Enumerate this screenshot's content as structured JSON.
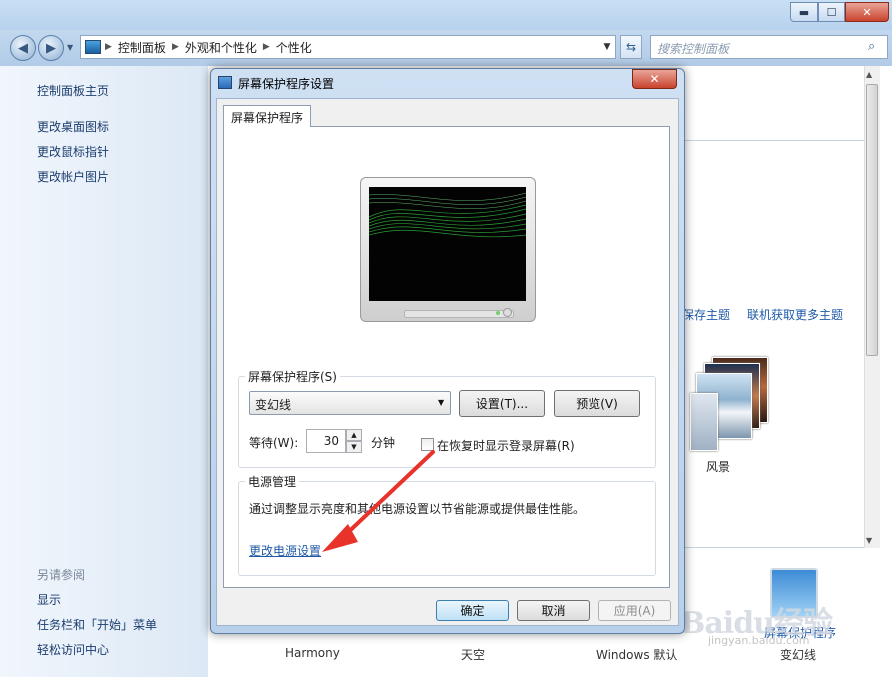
{
  "window": {
    "controls": {
      "minimize": "▬",
      "maximize": "☐",
      "close": "✕"
    }
  },
  "address_bar": {
    "segments": [
      "控制面板",
      "外观和个性化",
      "个性化"
    ],
    "search_placeholder": "搜索控制面板"
  },
  "sidebar": {
    "home": "控制面板主页",
    "links": [
      "更改桌面图标",
      "更改鼠标指针",
      "更改帐户图片"
    ],
    "see_also_title": "另请参阅",
    "see_also": [
      "显示",
      "任务栏和「开始」菜单",
      "轻松访问中心"
    ]
  },
  "background": {
    "save_theme_fragment": "保存主题",
    "get_more_themes": "联机获取更多主题",
    "theme_landscape": "风景",
    "bottom_labels": [
      "Harmony",
      "天空",
      "Windows 默认",
      "变幻线"
    ],
    "screensaver_link": "屏幕保护程序",
    "watermark": "Baidu经验",
    "watermark_url": "jingyan.baidu.com"
  },
  "dialog": {
    "title": "屏幕保护程序设置",
    "close": "✕",
    "tab": "屏幕保护程序",
    "screensaver_group": "屏幕保护程序(S)",
    "screensaver_selected": "变幻线",
    "settings_button": "设置(T)...",
    "preview_button": "预览(V)",
    "wait_label": "等待(W):",
    "wait_value": "30",
    "wait_unit": "分钟",
    "resume_checkbox": "在恢复时显示登录屏幕(R)",
    "power_group": "电源管理",
    "power_desc": "通过调整显示亮度和其他电源设置以节省能源或提供最佳性能。",
    "power_link": "更改电源设置",
    "ok": "确定",
    "cancel": "取消",
    "apply": "应用(A)"
  },
  "colors": {
    "link": "#1f5aa8",
    "annotation_arrow": "#e8322a"
  }
}
